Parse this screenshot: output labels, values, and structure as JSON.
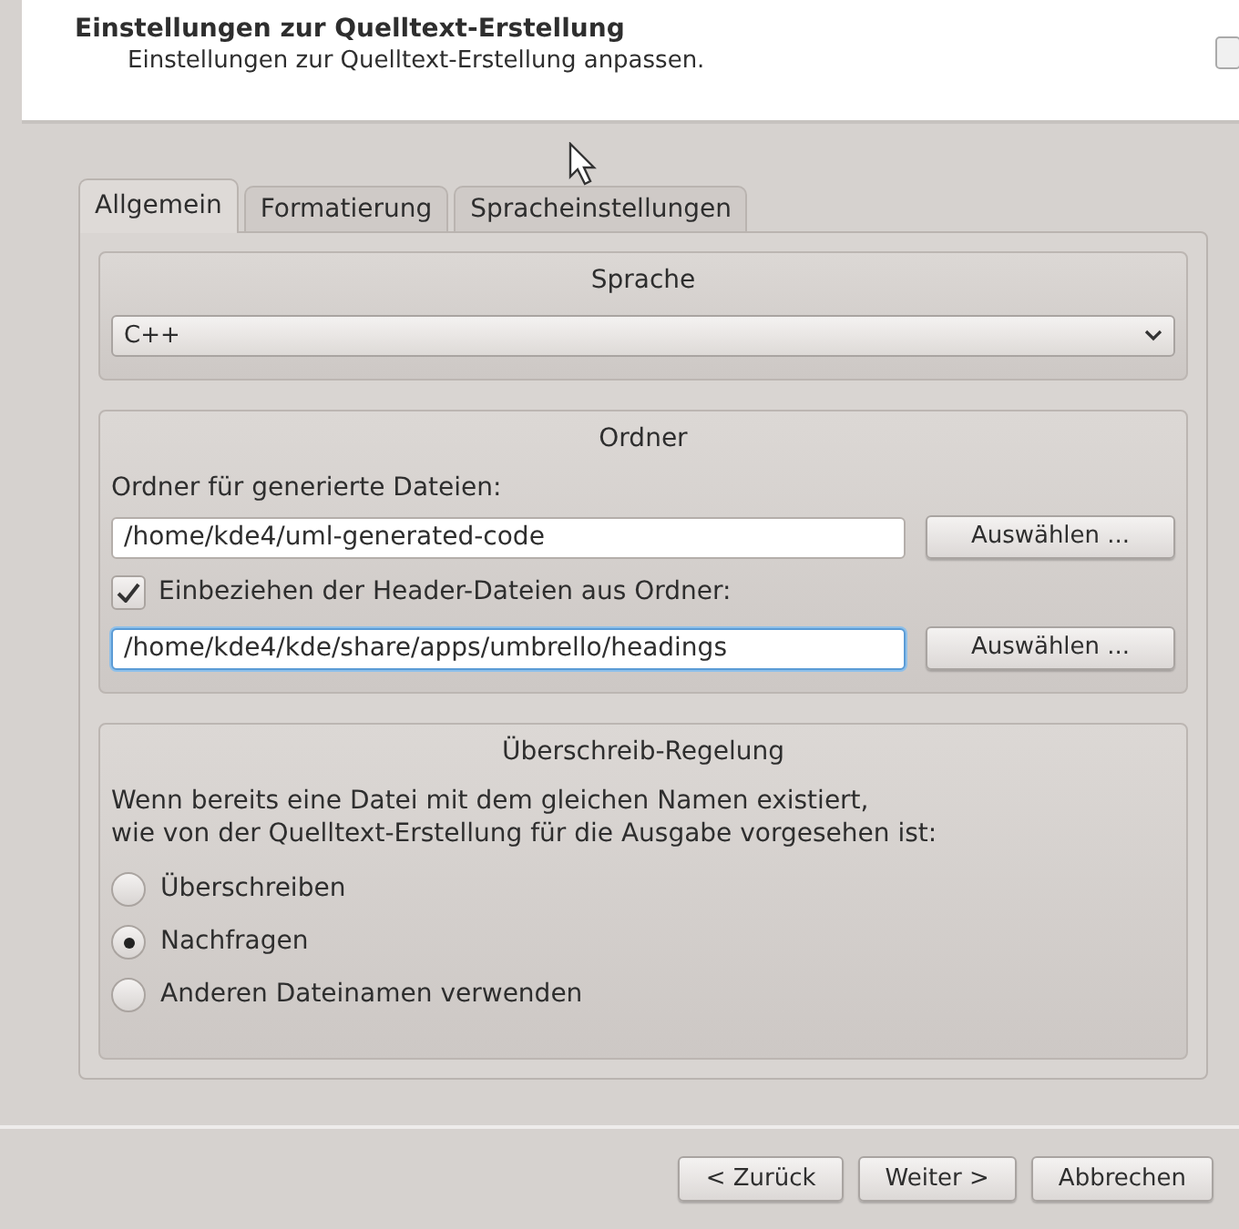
{
  "header": {
    "title": "Einstellungen zur Quelltext-Erstellung",
    "subtitle": "Einstellungen zur Quelltext-Erstellung anpassen."
  },
  "tabs": [
    {
      "label": "Allgemein",
      "selected": true
    },
    {
      "label": "Formatierung",
      "selected": false
    },
    {
      "label": "Spracheinstellungen",
      "selected": false
    }
  ],
  "language_group": {
    "title": "Sprache",
    "select_value": "C++"
  },
  "folder_group": {
    "title": "Ordner",
    "output_label": "Ordner für generierte Dateien:",
    "output_value": "/home/kde4/uml-generated-code",
    "output_button": "Auswählen ...",
    "include_checkbox": {
      "label": "Einbeziehen der Header-Dateien aus Ordner:",
      "checked": true
    },
    "include_value": "/home/kde4/kde/share/apps/umbrello/headings",
    "include_focused": true,
    "include_button": "Auswählen ..."
  },
  "overwrite_group": {
    "title": "Überschreib-Regelung",
    "description": "Wenn bereits eine Datei mit dem gleichen Namen existiert,\nwie von der Quelltext-Erstellung für die Ausgabe vorgesehen ist:",
    "options": [
      {
        "label": "Überschreiben",
        "selected": false
      },
      {
        "label": "Nachfragen",
        "selected": true
      },
      {
        "label": "Anderen Dateinamen verwenden",
        "selected": false
      }
    ]
  },
  "buttons": [
    "< Zurück",
    "Weiter >",
    "Abbrechen"
  ]
}
